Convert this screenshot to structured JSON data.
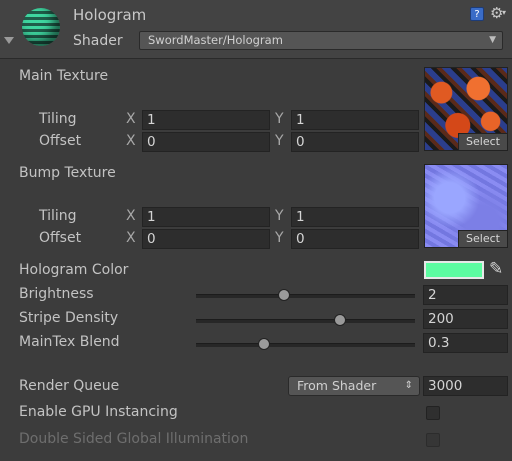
{
  "header": {
    "title": "Hologram",
    "shader_label": "Shader",
    "shader_value": "SwordMaster/Hologram",
    "help_icon": "help-book-icon",
    "gear_icon": "gear-icon"
  },
  "main_texture": {
    "label": "Main Texture",
    "tiling_label": "Tiling",
    "offset_label": "Offset",
    "tiling_x": "1",
    "tiling_y": "1",
    "offset_x": "0",
    "offset_y": "0",
    "select_label": "Select"
  },
  "bump_texture": {
    "label": "Bump Texture",
    "tiling_label": "Tiling",
    "offset_label": "Offset",
    "tiling_x": "1",
    "tiling_y": "1",
    "offset_x": "0",
    "offset_y": "0",
    "select_label": "Select"
  },
  "axis": {
    "x": "X",
    "y": "Y"
  },
  "hologram_color": {
    "label": "Hologram Color",
    "color": "#5dfca1"
  },
  "brightness": {
    "label": "Brightness",
    "value": "2"
  },
  "stripe_density": {
    "label": "Stripe Density",
    "value": "200"
  },
  "maintex_blend": {
    "label": "MainTex Blend",
    "value": "0.3"
  },
  "render_queue": {
    "label": "Render Queue",
    "mode": "From Shader",
    "value": "3000"
  },
  "gpu_instancing": {
    "label": "Enable GPU Instancing",
    "checked": false
  },
  "double_sided_gi": {
    "label": "Double Sided Global Illumination",
    "checked": false,
    "disabled": true
  }
}
